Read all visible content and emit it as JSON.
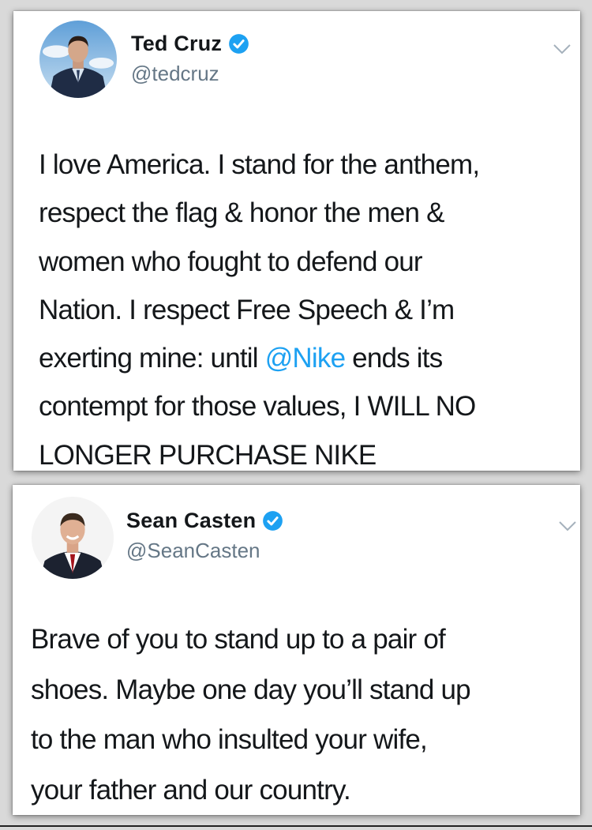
{
  "tweets": [
    {
      "display_name": "Ted Cruz",
      "handle": "@tedcruz",
      "verified": true,
      "lines": [
        {
          "text": "I love America. I stand for the anthem,"
        },
        {
          "text": "respect the flag & honor the men &"
        },
        {
          "text": "women who fought to defend our"
        },
        {
          "text": "Nation. I respect Free Speech & I’m"
        },
        {
          "before": "exerting mine: until ",
          "mention": "@Nike",
          "after": " ends its"
        },
        {
          "text": "contempt for those values, I WILL NO"
        },
        {
          "text": "LONGER PURCHASE NIKE"
        }
      ]
    },
    {
      "display_name": "Sean Casten",
      "handle": "@SeanCasten",
      "verified": true,
      "lines": [
        {
          "text": "Brave of you to stand up to a pair of"
        },
        {
          "text": "shoes.  Maybe one day you’ll stand up"
        },
        {
          "text": "to the man who insulted your wife,"
        },
        {
          "text": "your father and our country."
        }
      ]
    }
  ],
  "colors": {
    "text": "#14171a",
    "secondary": "#657786",
    "mention": "#1da1f2",
    "verified": "#1da1f2"
  },
  "icons": [
    "verified-badge-icon",
    "chevron-down-icon"
  ]
}
